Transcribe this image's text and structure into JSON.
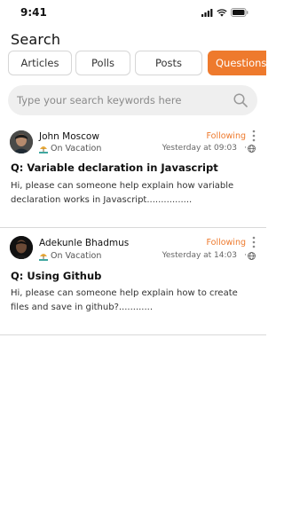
{
  "status_bar": {
    "time": "9:41",
    "icons": [
      "signal-icon",
      "wifi-icon",
      "battery-icon"
    ]
  },
  "page": {
    "title": "Search"
  },
  "tabs": [
    {
      "label": "Articles",
      "active": false
    },
    {
      "label": "Polls",
      "active": false
    },
    {
      "label": "Posts",
      "active": false
    },
    {
      "label": "Questions",
      "active": true
    }
  ],
  "search": {
    "placeholder": "Type your search keywords here",
    "value": "",
    "icon": "search-icon"
  },
  "colors": {
    "accent": "#ee7a2d",
    "divider": "#d9d9d9",
    "search_bg": "#efefef"
  },
  "posts": [
    {
      "author": "John Moscow",
      "status": "On Vacation",
      "status_icon": "beach-umbrella-icon",
      "follow_label": "Following",
      "timestamp": "Yesterday at 09:03",
      "separator": "·",
      "visibility_icon": "globe-icon",
      "title": "Q: Variable declaration in Javascript",
      "body": "Hi, please can someone help explain how variable declaration works in Javascript................"
    },
    {
      "author": "Adekunle Bhadmus",
      "status": "On Vacation",
      "status_icon": "beach-umbrella-icon",
      "follow_label": "Following",
      "timestamp": "Yesterday at 14:03",
      "separator": "·",
      "visibility_icon": "globe-icon",
      "title": "Q: Using Github",
      "body": "Hi, please can someone help explain how to create files and save in github?............"
    }
  ]
}
